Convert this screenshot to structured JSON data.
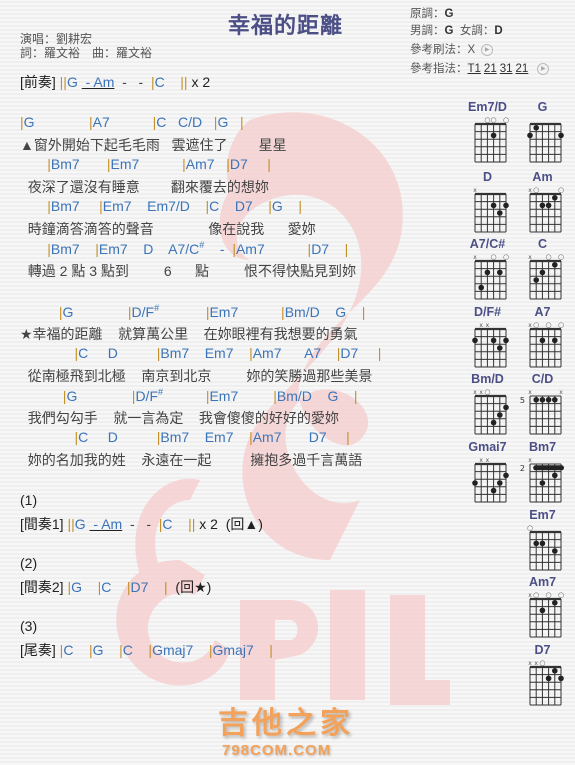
{
  "song": {
    "title": "幸福的距離",
    "singer_label": "演唱：劉耕宏",
    "lyricist_label": "詞：羅文裕",
    "composer_label": "曲：羅文裕"
  },
  "key_info": {
    "original_key_label": "原調：",
    "original_key": "G",
    "male_key_label": "男調：",
    "male_key": "G",
    "female_key_label": "女調：",
    "female_key": "D",
    "strum_label": "參考刷法：",
    "strum": "X",
    "pick_label": "參考指法：",
    "picks": [
      "T1",
      "21",
      "31",
      "21"
    ]
  },
  "colors": {
    "chord": "#3b74b8",
    "bar": "#c5902a",
    "title": "#4b4f86",
    "logo": "#f2a25a",
    "watermark": "#f3c9c9"
  },
  "sheet": {
    "intro": {
      "tag": "[前奏]",
      "bars": "||",
      "c1": "G",
      "ul": " - Am",
      "rest": "  -   -  ",
      "b2": "|",
      "c2": "C",
      "b3": "||",
      "rep": " x 2"
    },
    "verse": [
      {
        "type": "chord",
        "text": "|G              |A7           |C   C/D   |G   |"
      },
      {
        "type": "lyric",
        "text": "▲窗外開始下起毛毛雨   雲遮住了        星星"
      },
      {
        "type": "chord",
        "text": "       |Bm7       |Em7           |Am7   |D7     |"
      },
      {
        "type": "lyric",
        "text": "  夜深了還沒有睡意        翻來覆去的想妳"
      },
      {
        "type": "chord",
        "text": "       |Bm7     |Em7    Em7/D    |C    D7    |G    |"
      },
      {
        "type": "lyric",
        "text": "  時鐘滴答滴答的聲音              像在說我      愛妳"
      },
      {
        "type": "chord",
        "text": "       |Bm7    |Em7    D    A7/C#    -  |Am7           |D7    |"
      },
      {
        "type": "lyric",
        "text": "  轉過 2 點 3 點到         6      點         恨不得快點見到妳"
      }
    ],
    "chorus": [
      {
        "type": "chord",
        "text": "          |G              |D/F#            |Em7           |Bm/D    G    |"
      },
      {
        "type": "lyric",
        "text": "★幸福的距離    就算萬公里    在妳眼裡有我想要的勇氣"
      },
      {
        "type": "chord",
        "text": "              |C     D          |Bm7    Em7    |Am7      A7    |D7     |"
      },
      {
        "type": "lyric",
        "text": "  從南極飛到北極    南京到北京         妳的笑勝過那些美景"
      },
      {
        "type": "chord",
        "text": "           |G              |D/F#           |Em7         |Bm/D    G    |"
      },
      {
        "type": "lyric",
        "text": "  我們勾勾手    就一言為定    我會傻傻的好好的愛妳"
      },
      {
        "type": "chord",
        "text": "              |C     D          |Bm7    Em7    |Am7       D7     |"
      },
      {
        "type": "lyric",
        "text": "  妳的名加我的姓    永遠在一起          擁抱多過千言萬語"
      }
    ],
    "interlude1": {
      "num": "(1)",
      "tag": "[間奏1]",
      "bars": "||",
      "c1": "G",
      "ul": " - Am",
      "rest": "  -   -  ",
      "b2": "|",
      "c2": "C",
      "b3": "||",
      "rep": " x 2  (回▲)"
    },
    "interlude2": {
      "num": "(2)",
      "tag": "[間奏2]",
      "text": "|G    |C    |D7    |",
      "ret": "  (回★)"
    },
    "outro": {
      "num": "(3)",
      "tag": "[尾奏]",
      "text": "|C    |G    |C    |Gmaj7    |Gmaj7    |"
    }
  },
  "chord_diagrams": [
    {
      "name": "Em7/D",
      "marks": [
        "",
        "",
        "o",
        "o",
        "",
        "o"
      ],
      "fret_label": "",
      "dots": [
        [
          4,
          2
        ]
      ],
      "barre": null
    },
    {
      "name": "G",
      "marks": [
        "",
        "",
        "",
        "",
        "",
        ""
      ],
      "fret_label": "",
      "dots": [
        [
          1,
          2
        ],
        [
          2,
          1
        ],
        [
          6,
          2
        ]
      ],
      "barre": null
    },
    {
      "name": "D",
      "marks": [
        "x",
        "",
        "",
        "",
        "",
        ""
      ],
      "fret_label": "",
      "dots": [
        [
          4,
          2
        ],
        [
          5,
          3
        ],
        [
          6,
          2
        ]
      ],
      "barre": null
    },
    {
      "name": "Am",
      "marks": [
        "x",
        "o",
        "",
        "",
        "",
        "o"
      ],
      "fret_label": "",
      "dots": [
        [
          3,
          2
        ],
        [
          4,
          2
        ],
        [
          5,
          1
        ]
      ],
      "barre": null
    },
    {
      "name": "A7/C#",
      "marks": [
        "x",
        "",
        "",
        "o",
        "",
        "o"
      ],
      "fret_label": "",
      "dots": [
        [
          2,
          4
        ],
        [
          3,
          2
        ],
        [
          5,
          2
        ]
      ],
      "barre": null
    },
    {
      "name": "C",
      "marks": [
        "x",
        "",
        "",
        "o",
        "",
        "o"
      ],
      "fret_label": "",
      "dots": [
        [
          2,
          3
        ],
        [
          3,
          2
        ],
        [
          5,
          1
        ]
      ],
      "barre": null
    },
    {
      "name": "D/F#",
      "marks": [
        "",
        "x",
        "x",
        "",
        "",
        ""
      ],
      "fret_label": "",
      "dots": [
        [
          1,
          2
        ],
        [
          4,
          2
        ],
        [
          5,
          3
        ],
        [
          6,
          2
        ]
      ],
      "barre": null
    },
    {
      "name": "A7",
      "marks": [
        "x",
        "o",
        "",
        "o",
        "",
        "o"
      ],
      "fret_label": "",
      "dots": [
        [
          3,
          2
        ],
        [
          5,
          2
        ]
      ],
      "barre": null
    },
    {
      "name": "Bm/D",
      "marks": [
        "x",
        "x",
        "o",
        "",
        "",
        ""
      ],
      "fret_label": "",
      "dots": [
        [
          4,
          4
        ],
        [
          5,
          3
        ],
        [
          6,
          2
        ]
      ],
      "barre": null
    },
    {
      "name": "C/D",
      "marks": [
        "x",
        "",
        "",
        "",
        "",
        "x"
      ],
      "fret_label": "5",
      "dots": [
        [
          2,
          1
        ],
        [
          3,
          1
        ],
        [
          4,
          1
        ],
        [
          5,
          1
        ]
      ],
      "barre": null
    },
    {
      "name": "Gmai7",
      "marks": [
        "",
        "x",
        "x",
        "",
        "",
        ""
      ],
      "fret_label": "",
      "dots": [
        [
          1,
          3
        ],
        [
          4,
          4
        ],
        [
          5,
          3
        ],
        [
          6,
          2
        ]
      ],
      "barre": null
    },
    {
      "name": "Bm7",
      "marks": [
        "x",
        "",
        "",
        "",
        "",
        ""
      ],
      "fret_label": "2",
      "dots": [
        [
          3,
          3
        ],
        [
          5,
          2
        ]
      ],
      "barre": [
        2,
        6,
        1
      ]
    },
    {
      "name": "Em7",
      "marks": [
        "o",
        "",
        "",
        "",
        "",
        ""
      ],
      "fret_label": "",
      "dots": [
        [
          2,
          2
        ],
        [
          3,
          2
        ],
        [
          5,
          3
        ]
      ],
      "barre": null
    },
    {
      "name": "Am7",
      "marks": [
        "x",
        "o",
        "",
        "o",
        "",
        "o"
      ],
      "fret_label": "",
      "dots": [
        [
          3,
          2
        ],
        [
          5,
          1
        ]
      ],
      "barre": null
    },
    {
      "name": "D7",
      "marks": [
        "x",
        "x",
        "o",
        "",
        "",
        ""
      ],
      "fret_label": "",
      "dots": [
        [
          4,
          2
        ],
        [
          5,
          1
        ],
        [
          6,
          2
        ]
      ],
      "barre": null
    }
  ],
  "logo": {
    "cn": "吉他之家",
    "en": "798COM.COM"
  }
}
